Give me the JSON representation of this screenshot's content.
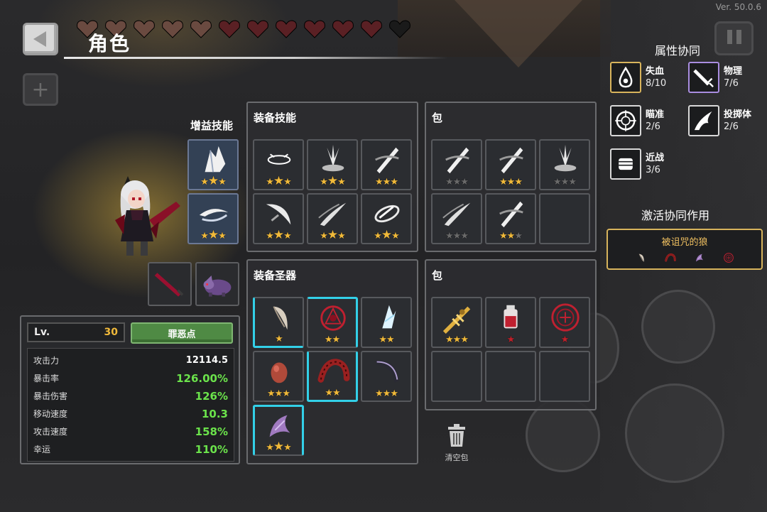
{
  "version": "Ver. 50.0.6",
  "header": {
    "title": "角色",
    "hearts_filled": 11,
    "hearts_total": 12
  },
  "character": {
    "buff_label": "增益技能",
    "buff_skills": [
      {
        "icon": "crystal-shard-icon",
        "stars": [
          1,
          2,
          1
        ]
      },
      {
        "icon": "white-swirl-icon",
        "stars": [
          1,
          2,
          1
        ]
      }
    ]
  },
  "equipped_skills": {
    "title": "装备技能",
    "slots": [
      {
        "icon": "white-ring-icon",
        "stars": [
          "s",
          "b",
          "s"
        ]
      },
      {
        "icon": "white-burst-icon",
        "stars": [
          "s",
          "b",
          "s"
        ]
      },
      {
        "icon": "slash-x-icon",
        "stars": [
          "s",
          "s",
          "s"
        ]
      },
      {
        "icon": "crescent-slash-icon",
        "stars": [
          "s",
          "b",
          "s"
        ]
      },
      {
        "icon": "wind-slash-icon",
        "stars": [
          "s",
          "b",
          "s"
        ]
      },
      {
        "icon": "orbit-slash-icon",
        "stars": [
          "s",
          "b",
          "s"
        ]
      }
    ]
  },
  "skill_bag": {
    "title": "包",
    "slots": [
      {
        "icon": "slash-x-icon",
        "stars": [
          "d",
          "d",
          "d"
        ]
      },
      {
        "icon": "slash-x-icon",
        "stars": [
          "s",
          "s",
          "s"
        ]
      },
      {
        "icon": "white-burst-icon",
        "stars": [
          "d",
          "d",
          "d"
        ]
      },
      {
        "icon": "wind-slash-icon",
        "stars": [
          "d",
          "d",
          "d"
        ]
      },
      {
        "icon": "slash-x-icon",
        "stars": [
          "s",
          "s",
          "d"
        ]
      },
      {
        "icon": "",
        "stars": []
      }
    ]
  },
  "equipped_relics": {
    "title": "装备圣器",
    "slots": [
      {
        "icon": "fang-icon",
        "stars": [
          "s"
        ]
      },
      {
        "icon": "red-sigil-icon",
        "stars": [
          "s",
          "s"
        ]
      },
      {
        "icon": "ice-crystal-icon",
        "stars": [
          "s",
          "s"
        ]
      },
      {
        "icon": "red-egg-icon",
        "stars": [
          "s",
          "s",
          "s"
        ]
      },
      {
        "icon": "red-centipede-icon",
        "stars": [
          "s",
          "s"
        ]
      },
      {
        "icon": "dark-scythe-icon",
        "stars": [
          "s",
          "s",
          "s"
        ]
      },
      {
        "icon": "purple-claw-icon",
        "stars": [
          "s",
          "b",
          "s"
        ]
      }
    ]
  },
  "relic_bag": {
    "title": "包",
    "slots": [
      {
        "icon": "golden-cross-sword-icon",
        "stars": [
          "s",
          "s",
          "s"
        ]
      },
      {
        "icon": "red-potion-icon",
        "stars": [
          "r"
        ]
      },
      {
        "icon": "red-rune-circle-icon",
        "stars": [
          "r"
        ]
      },
      {
        "icon": "",
        "stars": []
      },
      {
        "icon": "",
        "stars": []
      },
      {
        "icon": "",
        "stars": []
      }
    ]
  },
  "stats": {
    "lv_label": "Lv.",
    "lv_value": "30",
    "sin_button": "罪恶点",
    "rows": [
      {
        "label": "攻击力",
        "value": "12114.5",
        "color": "white"
      },
      {
        "label": "暴击率",
        "value": "126.00%",
        "color": "green"
      },
      {
        "label": "暴击伤害",
        "value": "126%",
        "color": "green"
      },
      {
        "label": "移动速度",
        "value": "10.3",
        "color": "green"
      },
      {
        "label": "攻击速度",
        "value": "158%",
        "color": "green"
      },
      {
        "label": "幸运",
        "value": "110%",
        "color": "green"
      }
    ]
  },
  "trash": {
    "label": "清空包"
  },
  "synergy": {
    "title": "属性协同",
    "items": [
      {
        "name": "失血",
        "count": "8/10",
        "icon": "blood-drop-icon",
        "border": "#d8b45c"
      },
      {
        "name": "物理",
        "count": "7/6",
        "icon": "sword-icon",
        "border": "#a98de0"
      },
      {
        "name": "瞄准",
        "count": "2/6",
        "icon": "crosshair-icon",
        "border": "#d8d8d8"
      },
      {
        "name": "投掷体",
        "count": "2/6",
        "icon": "flaming-projectile-icon",
        "border": "#d8d8d8"
      },
      {
        "name": "近战",
        "count": "3/6",
        "icon": "fist-icon",
        "border": "#d8d8d8"
      }
    ]
  },
  "activated": {
    "title": "激活协同作用",
    "name": "被诅咒的狼",
    "icons": [
      "fang-icon",
      "red-centipede-icon",
      "purple-claw-icon",
      "red-rune-circle-icon"
    ]
  },
  "colors": {
    "gold": "#f0b93a",
    "green_stat": "#6be34b",
    "cyan_link": "#33d0e8",
    "panel_border": "#6a6b6e"
  }
}
